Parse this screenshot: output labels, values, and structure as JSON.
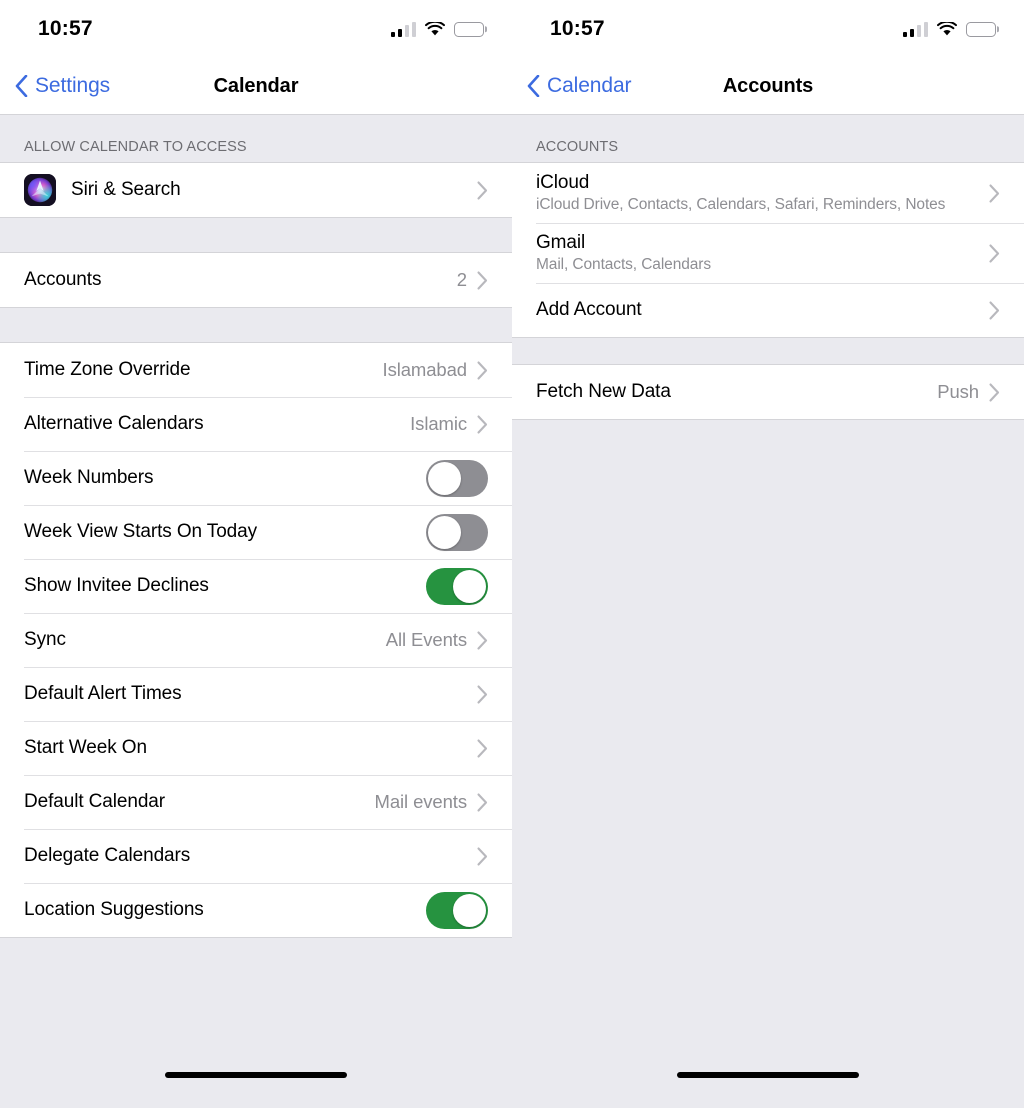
{
  "colors": {
    "accent_blue": "#3c6be0",
    "toggle_on_green": "#269340",
    "toggle_off_gray": "#8e8e93",
    "background_gray": "#eaeaef",
    "secondary_text": "#8e8e93",
    "section_header_text": "#6d6d72"
  },
  "left_screen": {
    "status": {
      "time": "10:57",
      "signal_icon": "cellular-signal-icon",
      "signal_bars_filled": 2,
      "signal_bars_total": 4,
      "wifi_icon": "wifi-icon",
      "battery_icon": "battery-icon",
      "battery_level_percent": 92
    },
    "nav": {
      "back_icon": "chevron-left-icon",
      "back_label": "Settings",
      "title": "Calendar"
    },
    "sections": [
      {
        "header": "ALLOW CALENDAR TO ACCESS",
        "rows": [
          {
            "label": "Siri & Search",
            "icon": "siri-app-icon",
            "accessory": "chevron-right-icon"
          }
        ]
      },
      {
        "header": "",
        "rows": [
          {
            "label": "Accounts",
            "value": "2",
            "accessory": "chevron-right-icon"
          }
        ]
      },
      {
        "header": "",
        "rows": [
          {
            "label": "Time Zone Override",
            "value": "Islamabad",
            "accessory": "chevron-right-icon"
          },
          {
            "label": "Alternative Calendars",
            "value": "Islamic",
            "accessory": "chevron-right-icon"
          },
          {
            "label": "Week Numbers",
            "accessory": "toggle",
            "toggle_on": false
          },
          {
            "label": "Week View Starts On Today",
            "accessory": "toggle",
            "toggle_on": false
          },
          {
            "label": "Show Invitee Declines",
            "accessory": "toggle",
            "toggle_on": true
          },
          {
            "label": "Sync",
            "value": "All Events",
            "accessory": "chevron-right-icon"
          },
          {
            "label": "Default Alert Times",
            "value": "",
            "accessory": "chevron-right-icon"
          },
          {
            "label": "Start Week On",
            "value": "",
            "accessory": "chevron-right-icon"
          },
          {
            "label": "Default Calendar",
            "value": "Mail events",
            "accessory": "chevron-right-icon"
          },
          {
            "label": "Delegate Calendars",
            "value": "",
            "accessory": "chevron-right-icon"
          },
          {
            "label": "Location Suggestions",
            "accessory": "toggle",
            "toggle_on": true
          }
        ]
      }
    ]
  },
  "right_screen": {
    "status": {
      "time": "10:57",
      "signal_icon": "cellular-signal-icon",
      "signal_bars_filled": 2,
      "signal_bars_total": 4,
      "wifi_icon": "wifi-icon",
      "battery_icon": "battery-icon",
      "battery_level_percent": 92
    },
    "nav": {
      "back_icon": "chevron-left-icon",
      "back_label": "Calendar",
      "title": "Accounts"
    },
    "sections": [
      {
        "header": "ACCOUNTS",
        "rows": [
          {
            "label": "iCloud",
            "sub": "iCloud Drive, Contacts, Calendars, Safari, Reminders, Notes",
            "accessory": "chevron-right-icon"
          },
          {
            "label": "Gmail",
            "sub": "Mail, Contacts, Calendars",
            "accessory": "chevron-right-icon"
          },
          {
            "label": "Add Account",
            "sub": "",
            "accessory": "chevron-right-icon"
          }
        ]
      },
      {
        "header": "",
        "rows": [
          {
            "label": "Fetch New Data",
            "value": "Push",
            "accessory": "chevron-right-icon"
          }
        ]
      }
    ]
  }
}
